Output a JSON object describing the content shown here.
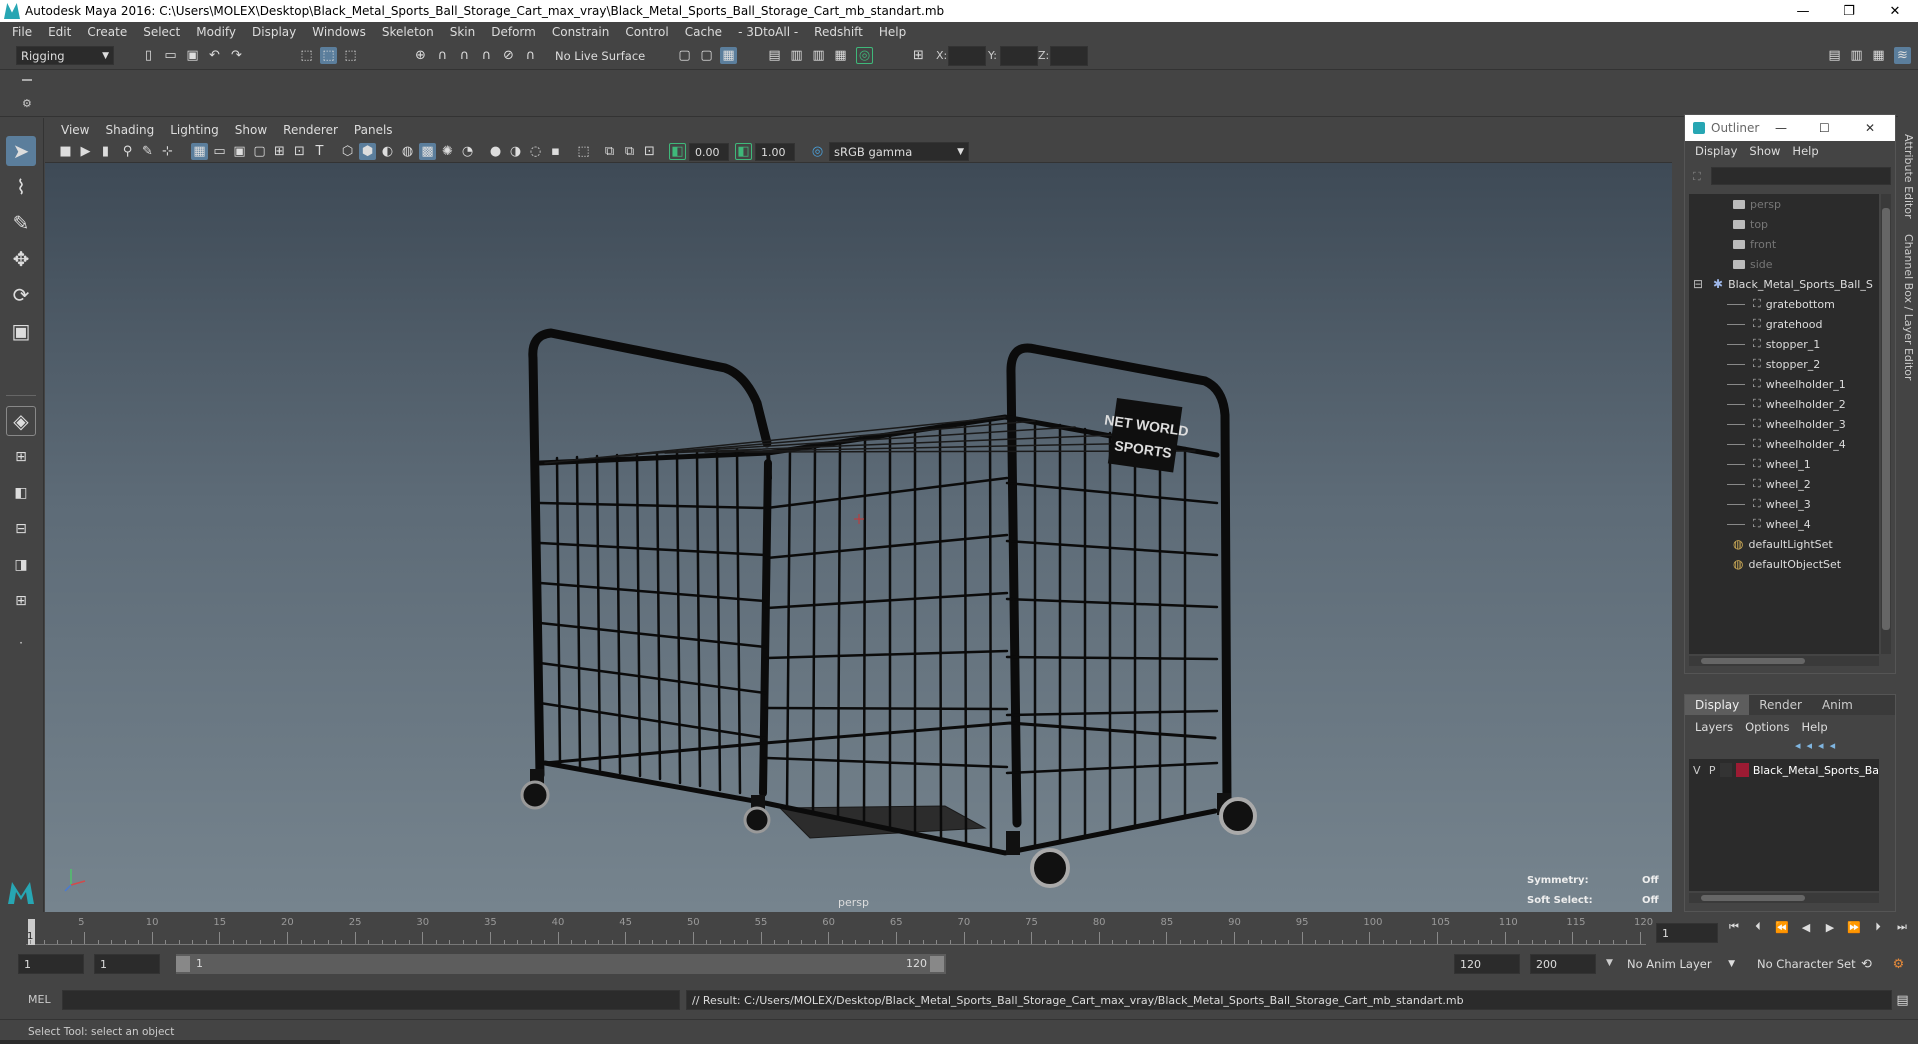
{
  "window": {
    "title": "Autodesk Maya 2016: C:\\Users\\MOLEX\\Desktop\\Black_Metal_Sports_Ball_Storage_Cart_max_vray\\Black_Metal_Sports_Ball_Storage_Cart_mb_standart.mb",
    "minimize": "—",
    "restore": "❐",
    "close": "✕"
  },
  "menubar": [
    "File",
    "Edit",
    "Create",
    "Select",
    "Modify",
    "Display",
    "Windows",
    "Skeleton",
    "Skin",
    "Deform",
    "Constrain",
    "Control",
    "Cache",
    "- 3DtoAll -",
    "Redshift",
    "Help"
  ],
  "toolbar": {
    "mode": "Rigging",
    "live_surface": "No Live Surface",
    "x_label": "X:",
    "y_label": "Y:",
    "z_label": "Z:"
  },
  "viewport": {
    "menu": [
      "View",
      "Shading",
      "Lighting",
      "Show",
      "Renderer",
      "Panels"
    ],
    "exposure": "0.00",
    "gamma": "1.00",
    "color_space": "sRGB gamma",
    "camera_label": "persp",
    "sign_line1": "NET WORLD",
    "sign_line2": "SPORTS",
    "symmetry_label": "Symmetry:",
    "symmetry_value": "Off",
    "soft_select_label": "Soft Select:",
    "soft_select_value": "Off"
  },
  "outliner": {
    "title": "Outliner",
    "menu": [
      "Display",
      "Show",
      "Help"
    ],
    "items": [
      {
        "label": "persp",
        "kind": "cam",
        "depth": 1,
        "dim": true
      },
      {
        "label": "top",
        "kind": "cam",
        "depth": 1,
        "dim": true
      },
      {
        "label": "front",
        "kind": "cam",
        "depth": 1,
        "dim": true
      },
      {
        "label": "side",
        "kind": "cam",
        "depth": 1,
        "dim": true
      },
      {
        "label": "Black_Metal_Sports_Ball_S",
        "kind": "root",
        "depth": 0,
        "dim": false
      },
      {
        "label": "gratebottom",
        "kind": "mesh",
        "depth": 2,
        "dim": false
      },
      {
        "label": "gratehood",
        "kind": "mesh",
        "depth": 2,
        "dim": false
      },
      {
        "label": "stopper_1",
        "kind": "mesh",
        "depth": 2,
        "dim": false
      },
      {
        "label": "stopper_2",
        "kind": "mesh",
        "depth": 2,
        "dim": false
      },
      {
        "label": "wheelholder_1",
        "kind": "mesh",
        "depth": 2,
        "dim": false
      },
      {
        "label": "wheelholder_2",
        "kind": "mesh",
        "depth": 2,
        "dim": false
      },
      {
        "label": "wheelholder_3",
        "kind": "mesh",
        "depth": 2,
        "dim": false
      },
      {
        "label": "wheelholder_4",
        "kind": "mesh",
        "depth": 2,
        "dim": false
      },
      {
        "label": "wheel_1",
        "kind": "mesh",
        "depth": 2,
        "dim": false
      },
      {
        "label": "wheel_2",
        "kind": "mesh",
        "depth": 2,
        "dim": false
      },
      {
        "label": "wheel_3",
        "kind": "mesh",
        "depth": 2,
        "dim": false
      },
      {
        "label": "wheel_4",
        "kind": "mesh",
        "depth": 2,
        "dim": false
      },
      {
        "label": "defaultLightSet",
        "kind": "set",
        "depth": 1,
        "dim": false
      },
      {
        "label": "defaultObjectSet",
        "kind": "set",
        "depth": 1,
        "dim": false
      }
    ]
  },
  "layers": {
    "tabs": [
      "Display",
      "Render",
      "Anim"
    ],
    "menu": [
      "Layers",
      "Options",
      "Help"
    ],
    "row": {
      "v": "V",
      "p": "P",
      "name": "Black_Metal_Sports_Ba",
      "color": "#9c1b33"
    }
  },
  "side_tabs": {
    "attribute": "Attribute Editor",
    "channel": "Channel Box / Layer Editor"
  },
  "timeline": {
    "labels": [
      "5",
      "10",
      "15",
      "20",
      "25",
      "30",
      "35",
      "40",
      "45",
      "50",
      "55",
      "60",
      "65",
      "70",
      "75",
      "80",
      "85",
      "90",
      "95",
      "100",
      "105",
      "110",
      "115",
      "120"
    ],
    "current_marker": "1",
    "current_frame": "1"
  },
  "range": {
    "start": "1",
    "start2": "1",
    "slider_start": "1",
    "slider_end": "120",
    "end": "120",
    "end2": "200",
    "anim_layer": "No Anim Layer",
    "char_set": "No Character Set"
  },
  "command": {
    "lang": "MEL",
    "result": "// Result: C:/Users/MOLEX/Desktop/Black_Metal_Sports_Ball_Storage_Cart_max_vray/Black_Metal_Sports_Ball_Storage_Cart_mb_standart.mb"
  },
  "status": {
    "help": "Select Tool: select an object"
  }
}
